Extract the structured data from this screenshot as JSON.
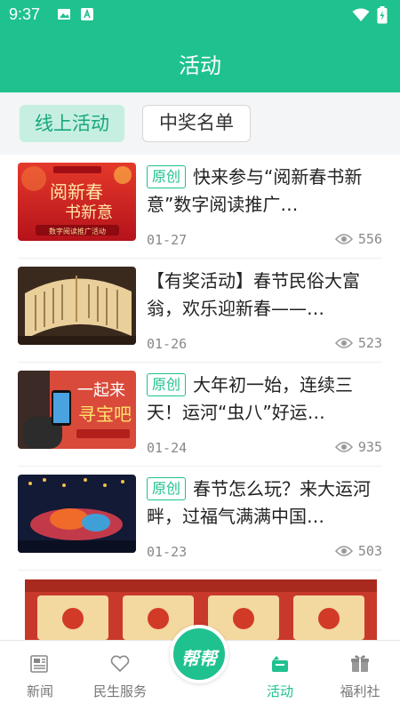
{
  "status_bar": {
    "time": "9:37"
  },
  "header": {
    "title": "活动"
  },
  "tabs": [
    {
      "label": "线上活动",
      "active": true
    },
    {
      "label": "中奖名单",
      "active": false
    }
  ],
  "articles": [
    {
      "badge": "原创",
      "title": "快来参与“阅新春书新意”数字阅读推广…",
      "date": "01-27",
      "views": "556",
      "thumb_text_1": "阅新春",
      "thumb_text_2": "书新意",
      "thumb_text_3": "数字阅读推广活动"
    },
    {
      "badge": "",
      "title": "【有奖活动】春节民俗大富翁，欢乐迎新春——…",
      "date": "01-26",
      "views": "523"
    },
    {
      "badge": "原创",
      "title": "大年初一始，连续三天！运河“虫八”好运…",
      "date": "01-24",
      "views": "935",
      "thumb_text_1": "一起来",
      "thumb_text_2": "寻宝吧"
    },
    {
      "badge": "原创",
      "title": "春节怎么玩？来大运河畔，过福气满满中国…",
      "date": "01-23",
      "views": "503"
    }
  ],
  "bottom_nav": {
    "items": [
      {
        "label": "新闻",
        "icon": "newspaper-icon"
      },
      {
        "label": "民生服务",
        "icon": "heart-icon"
      },
      {
        "label": "活动",
        "icon": "activity-bag-icon",
        "active": true
      },
      {
        "label": "福利社",
        "icon": "gift-icon"
      }
    ],
    "center_label": "帮帮"
  },
  "colors": {
    "accent": "#1fc18f",
    "tab_active_bg": "#c6efe2",
    "text_muted": "#888888"
  }
}
